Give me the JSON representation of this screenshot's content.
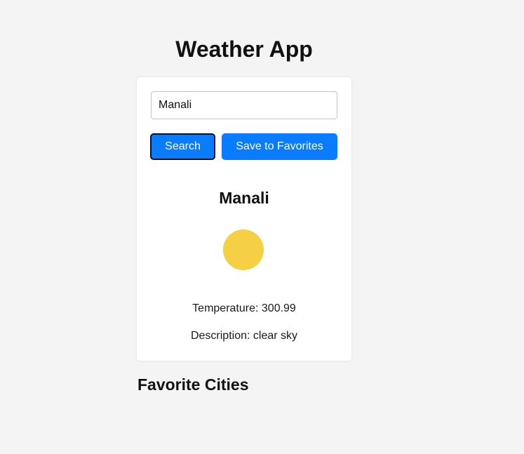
{
  "header": {
    "title": "Weather App"
  },
  "search": {
    "value": "Manali",
    "placeholder": "",
    "search_label": "Search",
    "save_label": "Save to Favorites"
  },
  "weather": {
    "city": "Manali",
    "icon": "sun-icon",
    "icon_color": "#f5cf44",
    "temperature_label": "Temperature:",
    "temperature_value": "300.99",
    "description_label": "Description:",
    "description_value": "clear sky"
  },
  "favorites": {
    "title": "Favorite Cities",
    "items": []
  },
  "colors": {
    "accent": "#0a7cff",
    "background": "#f4f4f4",
    "card": "#ffffff"
  }
}
